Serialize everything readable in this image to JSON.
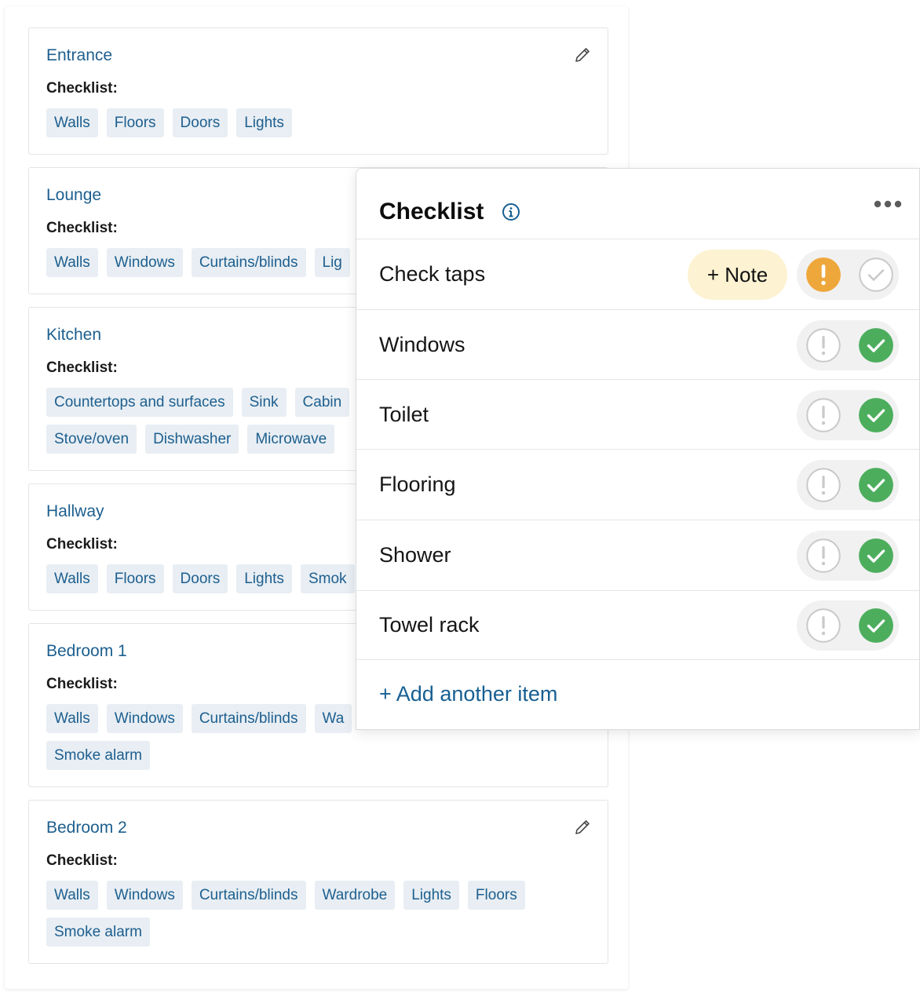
{
  "rooms": [
    {
      "name": "Entrance",
      "checklist_label": "Checklist:",
      "tag_rows": [
        [
          "Walls",
          "Floors",
          "Doors",
          "Lights"
        ]
      ]
    },
    {
      "name": "Lounge",
      "checklist_label": "Checklist:",
      "tag_rows": [
        [
          "Walls",
          "Windows",
          "Curtains/blinds",
          "Lig"
        ]
      ]
    },
    {
      "name": "Kitchen",
      "checklist_label": "Checklist:",
      "tag_rows": [
        [
          "Countertops and surfaces",
          "Sink",
          "Cabin"
        ],
        [
          "Stove/oven",
          "Dishwasher",
          "Microwave"
        ]
      ]
    },
    {
      "name": "Hallway",
      "checklist_label": "Checklist:",
      "tag_rows": [
        [
          "Walls",
          "Floors",
          "Doors",
          "Lights",
          "Smok"
        ]
      ]
    },
    {
      "name": "Bedroom 1",
      "checklist_label": "Checklist:",
      "tag_rows": [
        [
          "Walls",
          "Windows",
          "Curtains/blinds",
          "Wa"
        ],
        [
          "Smoke alarm"
        ]
      ]
    },
    {
      "name": "Bedroom 2",
      "checklist_label": "Checklist:",
      "tag_rows": [
        [
          "Walls",
          "Windows",
          "Curtains/blinds",
          "Wardrobe",
          "Lights",
          "Floors"
        ],
        [
          "Smoke alarm"
        ]
      ]
    }
  ],
  "popup": {
    "title": "Checklist",
    "note_label": "+ Note",
    "add_item_label": "+ Add another item",
    "items": [
      {
        "label": "Check taps",
        "status": "warning",
        "has_note_button": true
      },
      {
        "label": "Windows",
        "status": "ok"
      },
      {
        "label": "Toilet",
        "status": "ok"
      },
      {
        "label": "Flooring",
        "status": "ok"
      },
      {
        "label": "Shower",
        "status": "ok"
      },
      {
        "label": "Towel rack",
        "status": "ok"
      }
    ]
  },
  "colors": {
    "link_blue": "#1d5f8f",
    "tag_bg": "#e8eef3",
    "warning_orange": "#eea73b",
    "ok_green": "#4cae5d",
    "note_bg": "#fdf2d2"
  },
  "icons": {
    "edit": "pencil-icon",
    "info": "info-icon",
    "more": "more-horizontal-icon",
    "warning": "exclamation-icon",
    "ok": "checkmark-icon"
  }
}
